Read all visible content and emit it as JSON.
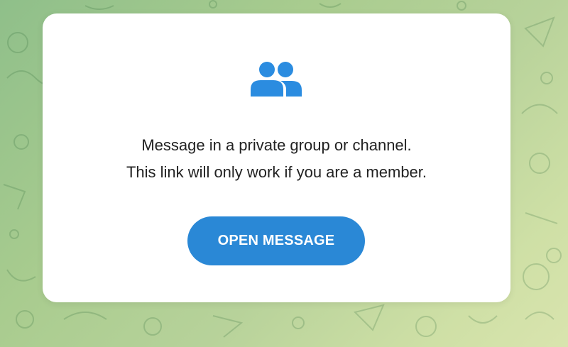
{
  "colors": {
    "accent": "#2a88d6",
    "icon": "#2b8ce0",
    "text": "#222222",
    "card_background": "#ffffff"
  },
  "dialog": {
    "icon": "group-icon",
    "message_line1": "Message in a private group or channel.",
    "message_line2": "This link will only work if you are a member.",
    "button_label": "OPEN MESSAGE"
  }
}
